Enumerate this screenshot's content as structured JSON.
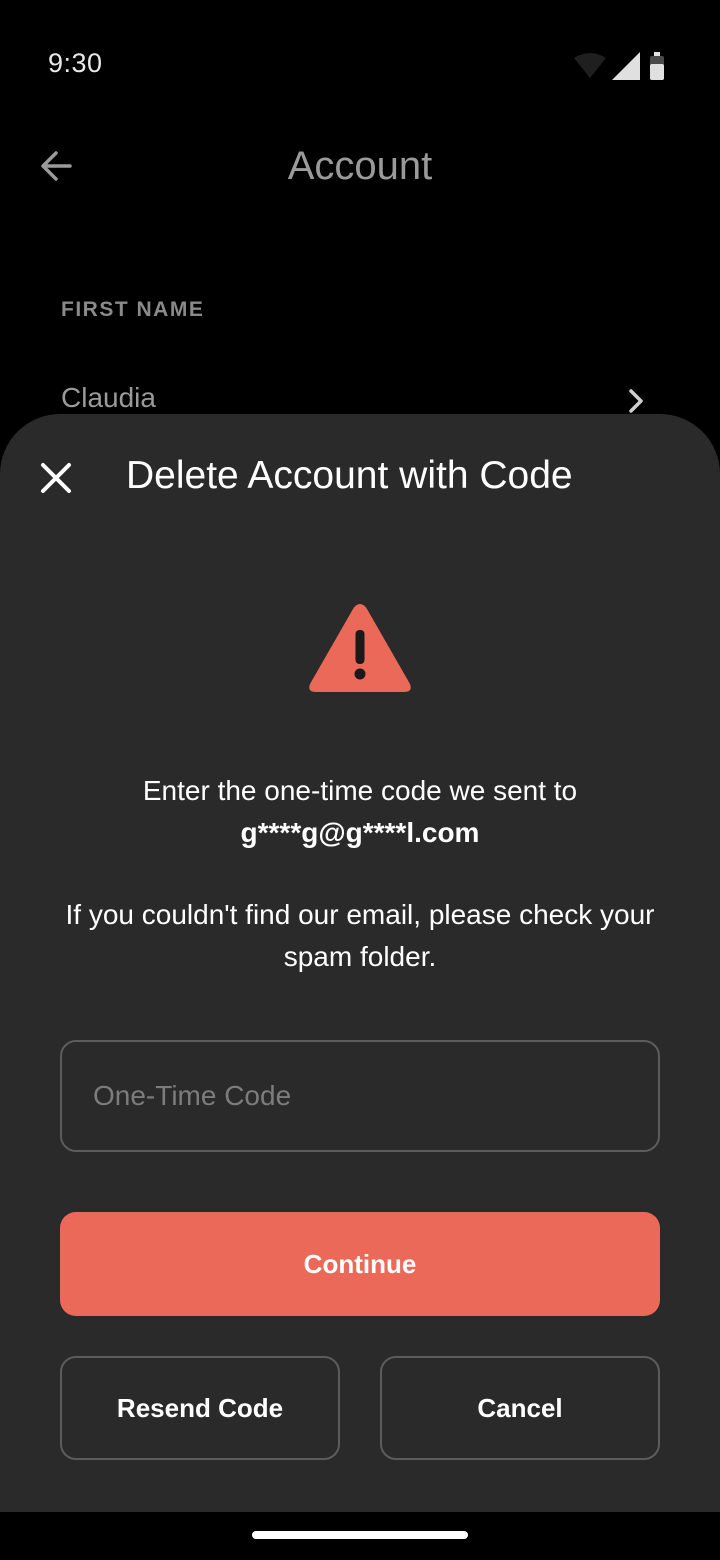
{
  "status_bar": {
    "time": "9:30",
    "icons": [
      "wifi-icon",
      "signal-icon",
      "battery-icon"
    ]
  },
  "app_bar": {
    "back_icon": "arrow-left-icon",
    "title": "Account"
  },
  "profile": {
    "first_name_label": "FIRST NAME",
    "first_name_value": "Claudia",
    "chevron_icon": "chevron-right-icon"
  },
  "sheet": {
    "close_icon": "close-icon",
    "title": "Delete Account with Code",
    "warning_icon": "warning-icon",
    "message": "Enter the one-time code we sent to",
    "email": "g****g@g****l.com",
    "hint": "If you couldn't find our email, please check your spam folder.",
    "code_placeholder": "One-Time Code",
    "code_value": "",
    "continue_label": "Continue",
    "resend_label": "Resend Code",
    "cancel_label": "Cancel"
  },
  "colors": {
    "background": "#000000",
    "sheet": "#2a2a2a",
    "accent": "#eb6959",
    "muted_text": "#9a9a9a",
    "border": "#5c5c5c"
  }
}
